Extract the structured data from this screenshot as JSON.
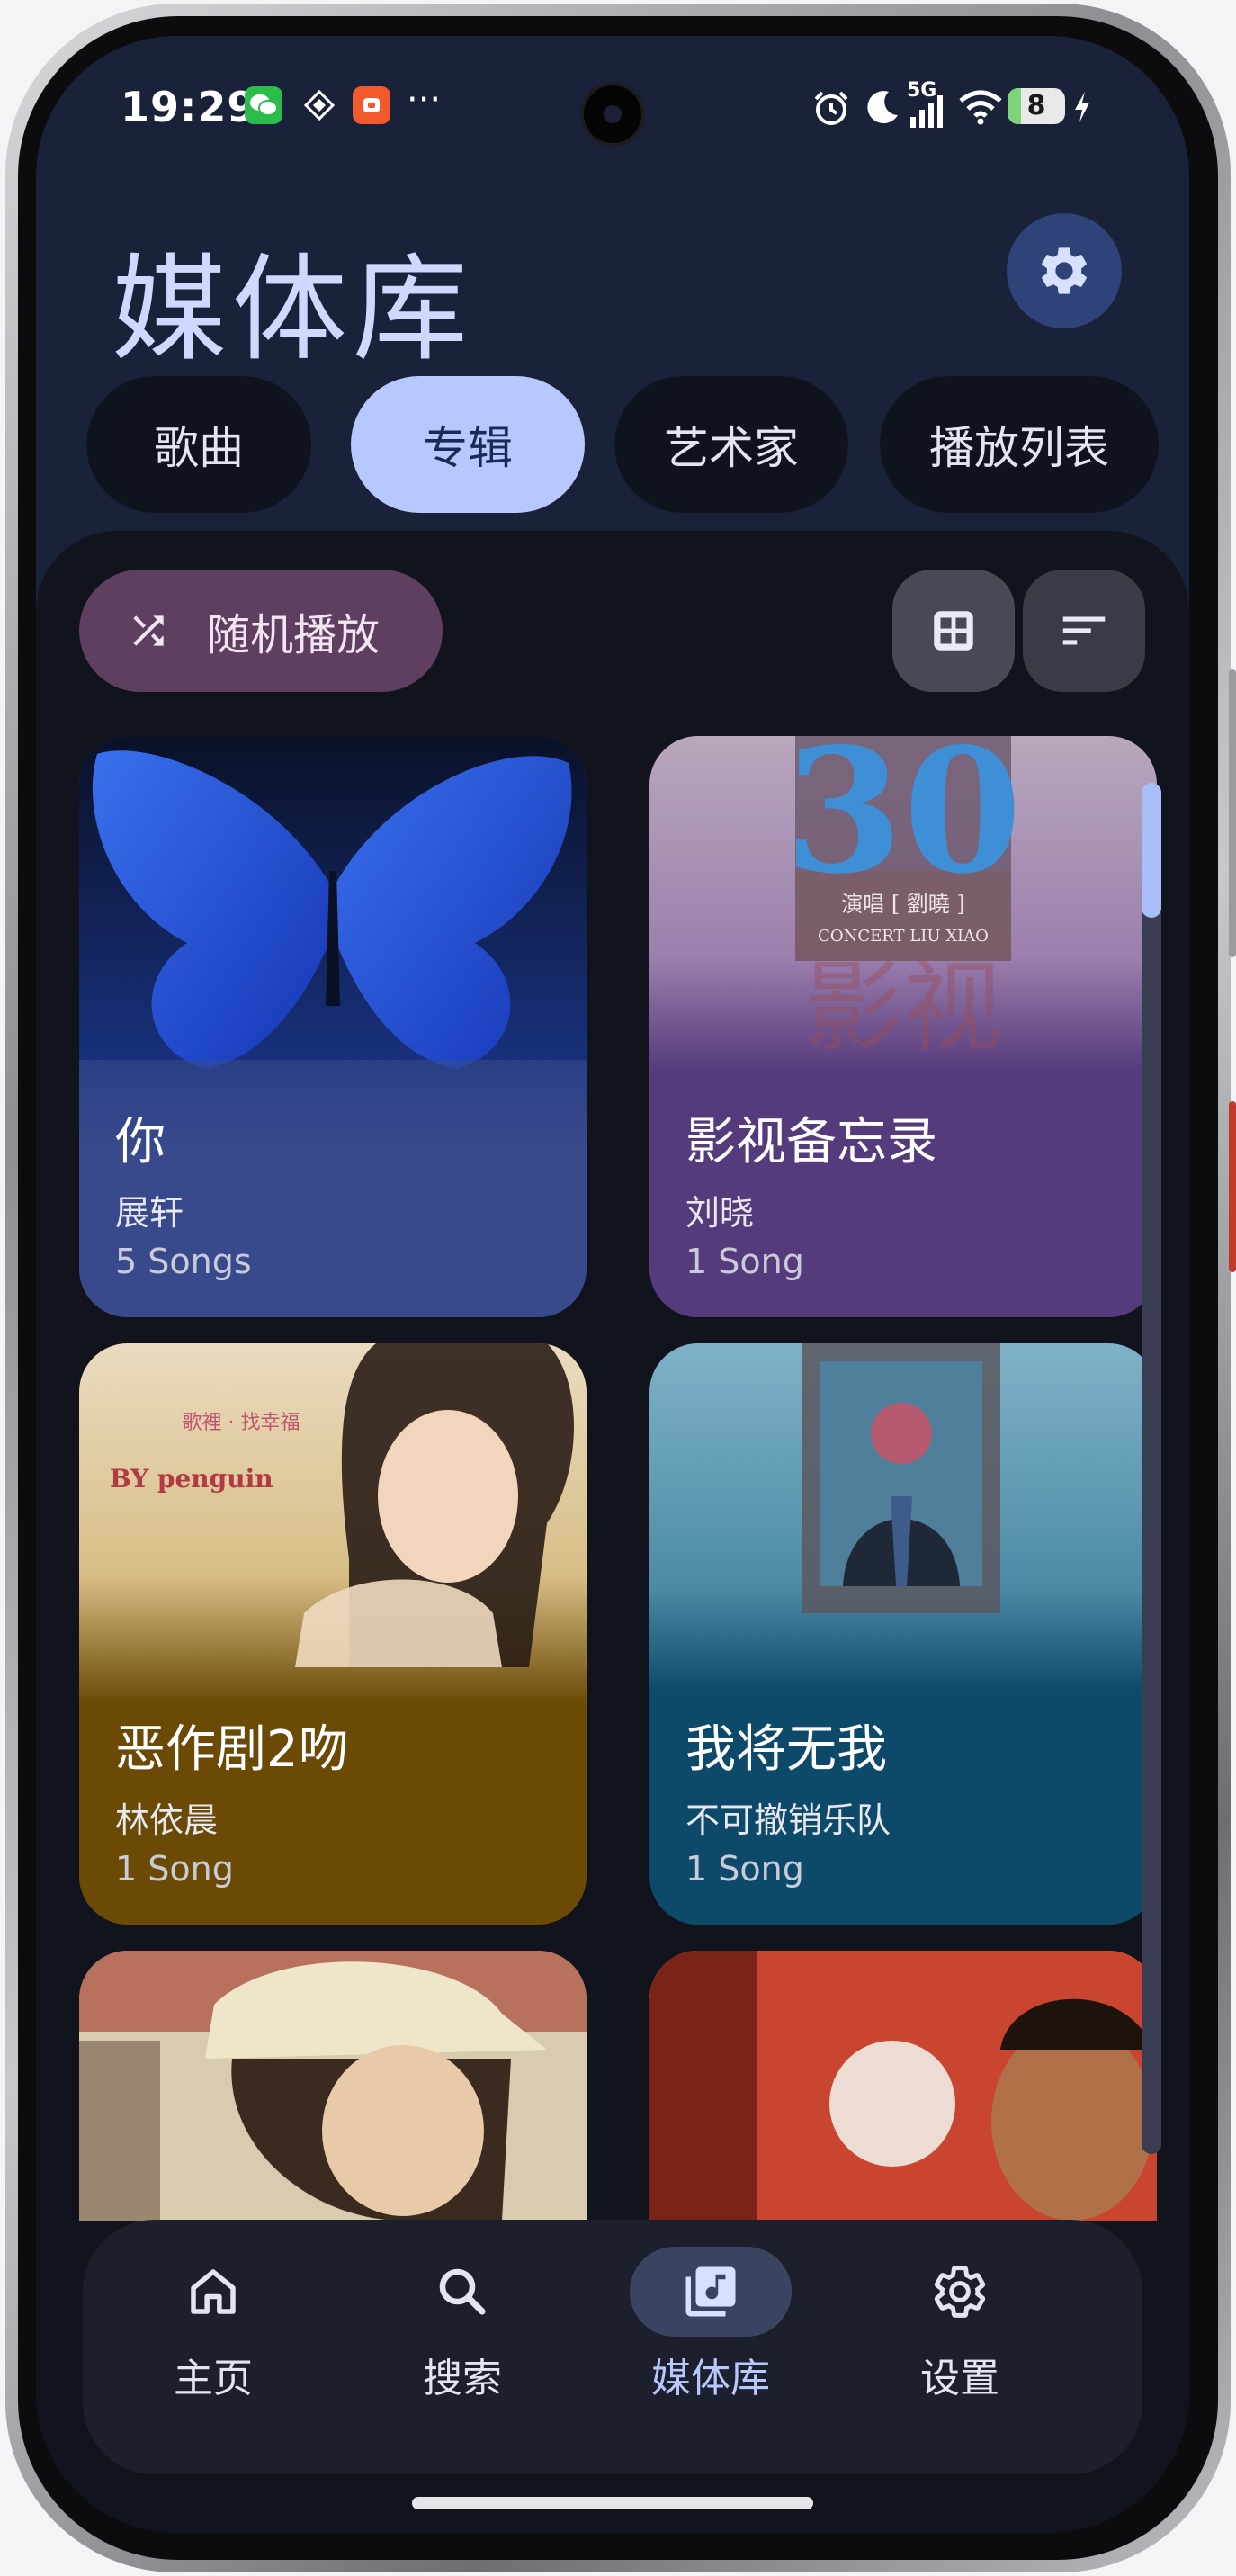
{
  "status_bar": {
    "time": "19:29",
    "network": "5G",
    "battery": "8",
    "battery_level": 0.08
  },
  "header": {
    "title": "媒体库"
  },
  "tabs": [
    {
      "label": "歌曲",
      "active": false
    },
    {
      "label": "专辑",
      "active": true
    },
    {
      "label": "艺术家",
      "active": false
    },
    {
      "label": "播放列表",
      "active": false
    }
  ],
  "toolbar": {
    "shuffle_label": "随机播放"
  },
  "albums": [
    {
      "title": "你",
      "artist": "展轩",
      "count": "5 Songs",
      "color": "#394b8c"
    },
    {
      "title": "影视备忘录",
      "artist": "刘晓",
      "count": "1 Song",
      "color": "#553a7c"
    },
    {
      "title": "恶作剧2吻",
      "artist": "林依晨",
      "count": "1 Song",
      "color": "#6a4a05"
    },
    {
      "title": "我将无我",
      "artist": "不可撤销乐队",
      "count": "1 Song",
      "color": "#0d4a6a"
    }
  ],
  "cover_text": {
    "album2_number": "30",
    "album2_performer": "演唱 [ 劉曉 ]",
    "album2_concert": "CONCERT LIU XIAO",
    "album2_big": "影视",
    "album3_line1": "歌裡 · 找幸福",
    "album3_line2": "BY penguin"
  },
  "nav": [
    {
      "label": "主页",
      "icon": "home-icon",
      "active": false
    },
    {
      "label": "搜索",
      "icon": "search-icon",
      "active": false
    },
    {
      "label": "媒体库",
      "icon": "library-music-icon",
      "active": true
    },
    {
      "label": "设置",
      "icon": "gear-icon",
      "active": false
    }
  ],
  "colors": {
    "accent": "#b8c8ff",
    "background": "#1a2239",
    "panel": "#11141c",
    "shuffle": "#5e3f5f"
  }
}
